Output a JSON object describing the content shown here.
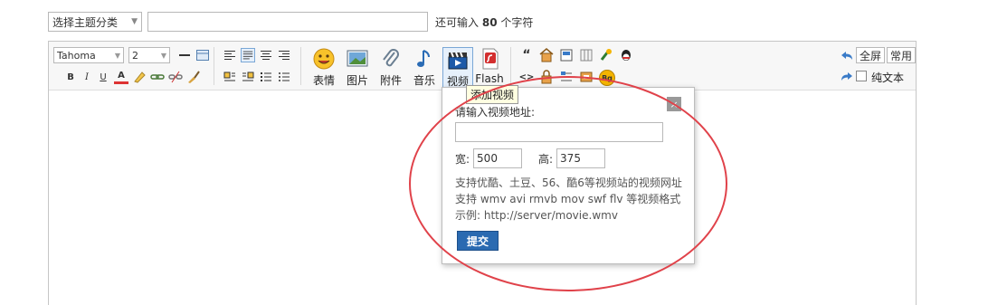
{
  "topbar": {
    "category_select": "选择主题分类",
    "remain_prefix": "还可输入",
    "remain_count": "80",
    "remain_suffix": "个字符"
  },
  "toolbar": {
    "font_family": "Tahoma",
    "font_size": "2",
    "buttons": {
      "emoticon": "表情",
      "image": "图片",
      "attachment": "附件",
      "music": "音乐",
      "video": "视频",
      "flash": "Flash"
    },
    "fullscreen": "全屏",
    "common": "常用",
    "plain_text": "纯文本",
    "bold": "B",
    "italic": "I",
    "underline": "U",
    "font_color": "A",
    "quote": "“",
    "code": "<>",
    "bg_badge": "Bg"
  },
  "tooltip": "添加视频",
  "popup": {
    "heading": "请输入视频地址:",
    "width_label": "宽:",
    "width_value": "500",
    "height_label": "高:",
    "height_value": "375",
    "note1": "支持优酷、土豆、56、酷6等视频站的视频网址",
    "note2": "支持 wmv avi rmvb mov swf flv 等视频格式",
    "note3": "示例: http://server/movie.wmv",
    "submit": "提交",
    "close": "×"
  },
  "colors": {
    "accent": "#2a6ab1",
    "highlight_ellipse": "#e0424a"
  }
}
